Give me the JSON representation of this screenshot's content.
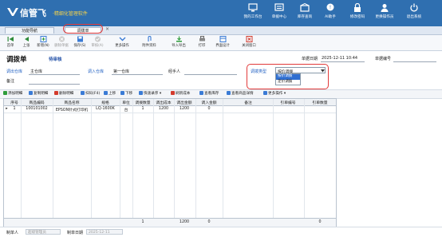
{
  "app": {
    "brand": "信管飞",
    "subbrand": "·精细化管理软件"
  },
  "top_nav": [
    {
      "label": "我的工作台",
      "icon": "desk-icon"
    },
    {
      "label": "单据中心",
      "icon": "documents-icon"
    },
    {
      "label": "库存查询",
      "icon": "inventory-icon"
    },
    {
      "label": "AI助手",
      "icon": "ai-assistant-icon"
    },
    {
      "label": "修改密码",
      "icon": "lock-icon"
    },
    {
      "label": "更换操作员",
      "icon": "switch-user-icon"
    },
    {
      "label": "退出系统",
      "icon": "power-icon"
    }
  ],
  "tabs": [
    {
      "label": "功能导航"
    },
    {
      "label": "调拨单",
      "close": "×"
    }
  ],
  "toolbar": [
    {
      "label": "首单",
      "icon": "first-icon",
      "enabled": true
    },
    {
      "label": "上张",
      "icon": "prev-icon",
      "enabled": true
    },
    {
      "label": "新增(N)",
      "icon": "add-icon",
      "enabled": true
    },
    {
      "label": "删除单据",
      "icon": "delete-icon",
      "enabled": false
    },
    {
      "label": "保存(S)",
      "icon": "save-icon",
      "enabled": true
    },
    {
      "label": "审核(A)",
      "icon": "audit-icon",
      "enabled": false
    },
    {
      "label": "更多操作",
      "icon": "more-icon",
      "enabled": true
    },
    {
      "label": "附件资料",
      "icon": "attachment-icon",
      "enabled": true
    },
    {
      "label": "导入导出",
      "icon": "import-export-icon",
      "enabled": true
    },
    {
      "label": "打印",
      "icon": "print-icon",
      "enabled": true
    },
    {
      "label": "界面设计",
      "icon": "design-icon",
      "enabled": true
    },
    {
      "label": "关闭窗口",
      "icon": "close-window-icon",
      "enabled": true
    }
  ],
  "form": {
    "title": "调拨单",
    "status": "待审核",
    "doc_date_label": "单据日期",
    "doc_date": "2025-12-11 10:44",
    "doc_no_label": "单据编号",
    "doc_no": "",
    "out_wh_label": "调出仓库",
    "out_wh": "主仓库",
    "in_wh_label": "调入仓库",
    "in_wh": "第一仓库",
    "handler_label": "经手人",
    "handler": "",
    "type_label": "调拨类型",
    "type_value": "按价调拨",
    "type_options": [
      "按价调拨",
      "定价调拨"
    ],
    "remark_label": "备注",
    "remark": ""
  },
  "grid_toolbar": [
    {
      "label": "添加明细",
      "icon": "add-row-icon",
      "color": "#2e9c3a"
    },
    {
      "label": "复制明细",
      "icon": "copy-row-icon",
      "color": "#3a7bd5"
    },
    {
      "label": "删除明细",
      "icon": "delete-row-icon",
      "color": "#d33a2c"
    },
    {
      "label": "扫码(F4)",
      "icon": "scan-icon",
      "color": "#3a7bd5"
    },
    {
      "label": "上移",
      "icon": "up-icon",
      "color": "#3a7bd5"
    },
    {
      "label": "下移",
      "icon": "down-icon",
      "color": "#3a7bd5"
    },
    {
      "label": "快速录序 ▾",
      "icon": "quick-entry-icon",
      "color": "#3a7bd5"
    },
    {
      "label": "刷新成本",
      "icon": "refresh-cost-icon",
      "color": "#d33a2c"
    },
    {
      "label": "查看库存",
      "icon": "stock-icon",
      "color": "#3a7bd5"
    },
    {
      "label": "查看商品详情",
      "icon": "detail-icon",
      "color": "#3a7bd5"
    },
    {
      "label": "更多操作 ▾",
      "icon": "more-ops-icon",
      "color": "#3a7bd5"
    }
  ],
  "table": {
    "columns": [
      "序号",
      "商品编码",
      "商品名称",
      "规格",
      "单位",
      "调拨数量",
      "调出成本",
      "调出金额",
      "调入金额",
      "备注",
      "引单编号",
      "引单数量"
    ],
    "rows": [
      [
        "1",
        "100101002",
        "EPSON针式打印机",
        "LQ-1600K",
        "台",
        "1",
        "1200",
        "1200",
        "0",
        "",
        "",
        ""
      ]
    ],
    "row_marker": "▸",
    "footer": {
      "qty_total": "1",
      "amount_total": "1200",
      "in_amount_total": "0",
      "ref_qty_total": "0"
    }
  },
  "bottom": {
    "maker_label": "制单人",
    "maker": "超级管理员",
    "make_date_label": "制单日期",
    "make_date": "2025-12-11"
  }
}
